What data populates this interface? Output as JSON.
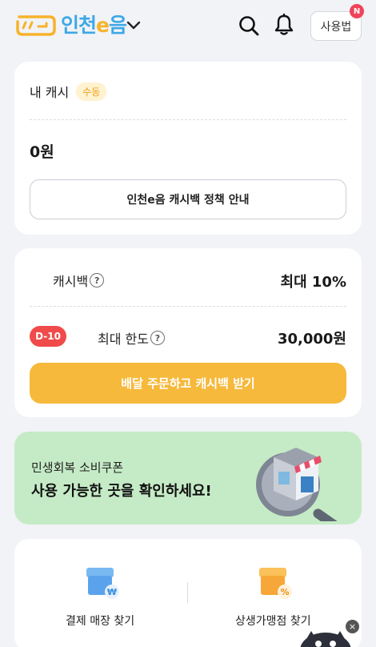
{
  "header": {
    "app_name": "인천e음",
    "app_name_prefix": "인천",
    "app_name_e": "e",
    "app_name_suffix": "음",
    "dropdown_icon": "chevron-down-icon",
    "search_icon": "search-icon",
    "bell_icon": "bell-icon",
    "guide_label": "사용법",
    "guide_badge": "N"
  },
  "cash": {
    "title": "내 캐시",
    "mode_badge": "수동",
    "balance": "0원",
    "policy_button": "인천e음 캐시백 정책 안내"
  },
  "cashback": {
    "label": "캐시백",
    "help_glyph": "?",
    "value": "최대 10%",
    "dday": "D-10",
    "limit_label": "최대 한도",
    "limit_value": "30,000원",
    "cta": "배달 주문하고 캐시백 받기"
  },
  "banner": {
    "subtitle": "민생회복 소비쿠폰",
    "title": "사용 가능한 곳을 확인하세요!"
  },
  "finder": {
    "left_label": "결제 매장 찾기",
    "left_badge": "₩",
    "right_label": "상생가맹점 찾기",
    "right_badge": "%"
  },
  "float": {
    "close_glyph": "×"
  },
  "colors": {
    "accent": "#f6b93b",
    "brand_blue": "#3ea8e6",
    "danger": "#f04a4a",
    "banner_bg": "#c5ebc6"
  }
}
